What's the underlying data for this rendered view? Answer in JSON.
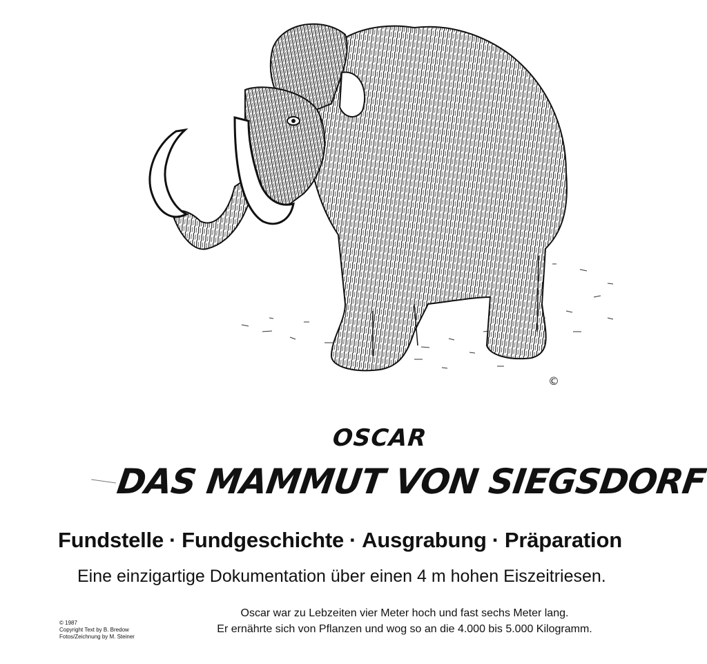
{
  "copyright_mark": "©",
  "title": {
    "name": "OSCAR",
    "main": "DAS MAMMUT VON SIEGSDORF"
  },
  "topics": [
    "Fundstelle",
    "Fundgeschichte",
    "Ausgrabung",
    "Präparation"
  ],
  "topic_separator": "·",
  "subtitle": "Eine einzigartige Dokumentation über einen 4 m hohen Eiszeitriesen.",
  "description": {
    "line1": "Oscar war zu Lebzeiten vier Meter hoch und fast sechs Meter lang.",
    "line2": "Er ernährte sich von Pflanzen und wog so an die 4.000 bis 5.000 Kilogramm."
  },
  "credits": {
    "year": "© 1987",
    "text": "Copyright Text by B. Bredow",
    "photos": "Fotos/Zeichnung by M. Steiner"
  }
}
